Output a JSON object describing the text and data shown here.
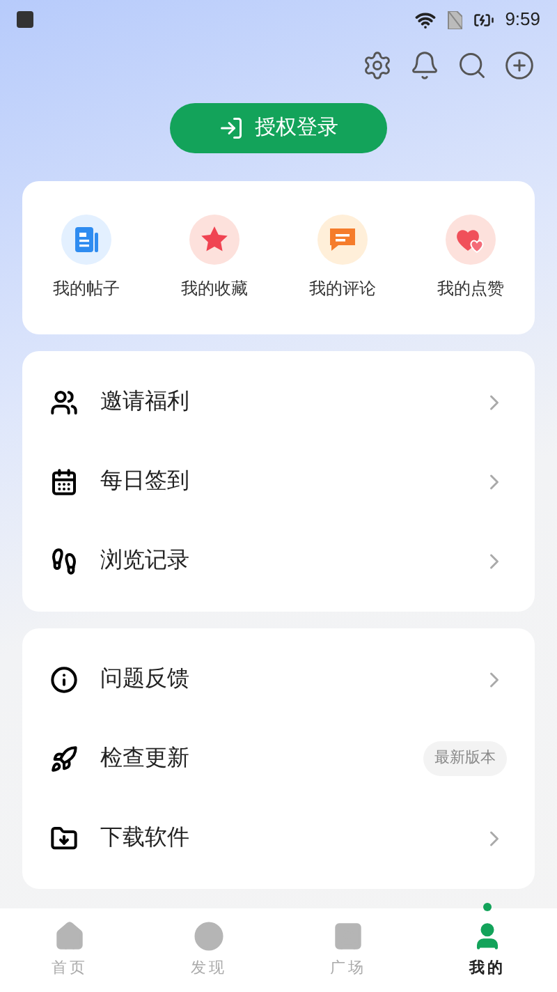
{
  "status_bar": {
    "time": "9:59"
  },
  "login_button": {
    "label": "授权登录"
  },
  "shortcuts": [
    {
      "label": "我的帖子"
    },
    {
      "label": "我的收藏"
    },
    {
      "label": "我的评论"
    },
    {
      "label": "我的点赞"
    }
  ],
  "menu_groups": [
    [
      {
        "label": "邀请福利",
        "kind": "chevron"
      },
      {
        "label": "每日签到",
        "kind": "chevron"
      },
      {
        "label": "浏览记录",
        "kind": "chevron"
      }
    ],
    [
      {
        "label": "问题反馈",
        "kind": "chevron"
      },
      {
        "label": "检查更新",
        "kind": "badge",
        "badge": "最新版本"
      },
      {
        "label": "下载软件",
        "kind": "chevron"
      }
    ]
  ],
  "bottom_nav": [
    {
      "label": "首页",
      "selected": false
    },
    {
      "label": "发现",
      "selected": false
    },
    {
      "label": "广场",
      "selected": false
    },
    {
      "label": "我的",
      "selected": true
    }
  ]
}
